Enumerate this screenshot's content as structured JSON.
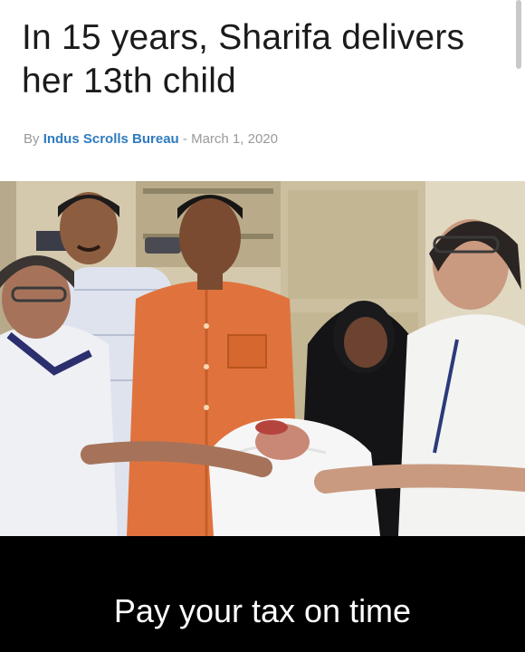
{
  "article": {
    "headline": "In 15 years, Sharifa delivers her 13th child",
    "byline_prefix": "By ",
    "author": "Indus Scrolls Bureau",
    "separator": " - ",
    "date": "March 1, 2020"
  },
  "photo": {
    "subject": "group-photo-newborn-handover"
  },
  "meme": {
    "caption": "Pay your tax on time"
  },
  "colors": {
    "page_background": "#ffffff",
    "headline": "#1b1b1b",
    "byline": "#9a9a9a",
    "author_link": "#2f7bbf",
    "caption_background": "#000000",
    "caption_text": "#ffffff"
  }
}
